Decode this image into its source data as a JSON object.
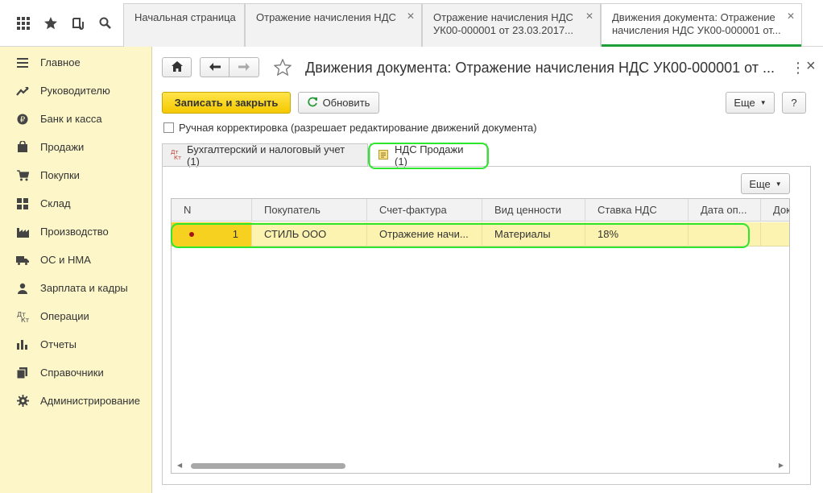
{
  "topbar": {
    "icons": [
      "apps-grid-icon",
      "star-icon",
      "history-icon",
      "search-icon"
    ],
    "tabs": [
      {
        "label": "Начальная страница"
      },
      {
        "label": "Отражение начисления НДС"
      },
      {
        "label": "Отражение начисления НДС УК00-000001 от 23.03.2017..."
      },
      {
        "label": "Движения документа: Отражение начисления НДС УК00-000001 от..."
      }
    ]
  },
  "sidebar": {
    "items": [
      {
        "label": "Главное",
        "icon": "menu-lines-icon"
      },
      {
        "label": "Руководителю",
        "icon": "trend-icon"
      },
      {
        "label": "Банк и касса",
        "icon": "ruble-coin-icon"
      },
      {
        "label": "Продажи",
        "icon": "shopping-bag-icon"
      },
      {
        "label": "Покупки",
        "icon": "cart-icon"
      },
      {
        "label": "Склад",
        "icon": "warehouse-icon"
      },
      {
        "label": "Производство",
        "icon": "factory-icon"
      },
      {
        "label": "ОС и НМА",
        "icon": "truck-icon"
      },
      {
        "label": "Зарплата и кадры",
        "icon": "people-icon"
      },
      {
        "label": "Операции",
        "icon": "debit-credit-icon"
      },
      {
        "label": "Отчеты",
        "icon": "bar-chart-icon"
      },
      {
        "label": "Справочники",
        "icon": "books-icon"
      },
      {
        "label": "Администрирование",
        "icon": "gear-icon"
      }
    ]
  },
  "header": {
    "title": "Движения документа: Отражение начисления НДС УК00-000001 от ...",
    "more_glyph": "⋮",
    "close_glyph": "×"
  },
  "toolbar": {
    "save_close_label": "Записать и закрыть",
    "refresh_label": "Обновить",
    "more_label": "Еще",
    "help_label": "?"
  },
  "manual_correction": {
    "label": "Ручная корректировка (разрешает редактирование движений документа)",
    "checked": false
  },
  "doc_tabs": [
    {
      "label": "Бухгалтерский и налоговый учет (1)",
      "icon": "debit-credit-icon"
    },
    {
      "label": "НДС Продажи (1)",
      "icon": "register-icon"
    }
  ],
  "grid_toolbar": {
    "more_label": "Еще"
  },
  "grid": {
    "columns": [
      "N",
      "Покупатель",
      "Счет-фактура",
      "Вид ценности",
      "Ставка НДС",
      "Дата оп...",
      "Док"
    ],
    "rows": [
      {
        "n": "1",
        "buyer": "СТИЛЬ ООО",
        "invoice": "Отражение начи...",
        "value_type": "Материалы",
        "vat_rate": "18%",
        "op_date": "",
        "doc": ""
      }
    ]
  },
  "colors": {
    "accent_yellow": "#f5c900",
    "sidebar_bg": "#fcf6c9",
    "highlight_green": "#2ee62e",
    "active_tab_line": "#1f9e3a",
    "row_selected": "#fcf3b0"
  }
}
